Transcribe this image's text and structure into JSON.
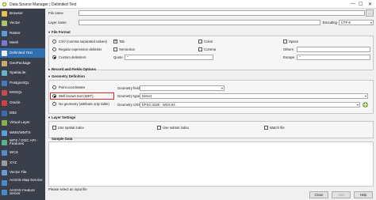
{
  "window": {
    "title": "Data Source Manager | Delimited Text",
    "controls": [
      "—",
      "☐",
      "✕"
    ]
  },
  "sidebar": {
    "items": [
      {
        "label": "Browser",
        "color": "#e8c24a",
        "active": false
      },
      {
        "label": "Vector",
        "color": "#a9c96a",
        "active": false
      },
      {
        "label": "Raster",
        "color": "#5d9bd5",
        "active": false
      },
      {
        "label": "Mesh",
        "color": "#7a7ac9",
        "active": false
      },
      {
        "label": "Delimited Text",
        "color": "#f0f0f0",
        "active": true
      },
      {
        "label": "GeoPackage",
        "color": "#c9a96a",
        "active": false
      },
      {
        "label": "SpatiaLite",
        "color": "#6ab0c9",
        "active": false
      },
      {
        "label": "PostgreSQL",
        "color": "#4a7ab5",
        "active": false
      },
      {
        "label": "MSSQL",
        "color": "#c94a4a",
        "active": false
      },
      {
        "label": "Oracle",
        "color": "#d04040",
        "active": false
      },
      {
        "label": "DB2",
        "color": "#3a6ab0",
        "active": false
      },
      {
        "label": "Virtual Layer",
        "color": "#8ab04a",
        "active": false
      },
      {
        "label": "WMS/WMTS",
        "color": "#5aa0d0",
        "active": false
      },
      {
        "label": "WFS / OGC API - Features",
        "color": "#5ab08a",
        "active": false
      },
      {
        "label": "WCS",
        "color": "#5a8ad0",
        "active": false
      },
      {
        "label": "XYZ",
        "color": "#9a9a9a",
        "active": false
      },
      {
        "label": "Vector Tile",
        "color": "#6a9ad0",
        "active": false
      },
      {
        "label": "ArcGIS Map Service",
        "color": "#4a8ac9",
        "active": false
      },
      {
        "label": "ArcGIS Feature Server",
        "color": "#4a8ac9",
        "active": false
      }
    ]
  },
  "file": {
    "file_name_label": "File name",
    "browse": "…",
    "layer_name_label": "Layer name",
    "encoding_label": "Encoding",
    "encoding_value": "UTF-8"
  },
  "file_format": {
    "title": "File Format",
    "csv": "CSV (comma separated values)",
    "regex": "Regular expression delimiter",
    "custom": "Custom delimiters",
    "tab": "Tab",
    "semicolon": "Semicolon",
    "colon": "Colon",
    "comma": "Comma",
    "space": "Space",
    "others": "Others",
    "quote_label": "Quote",
    "quote_value": "\"",
    "escape_label": "Escape",
    "escape_value": "\""
  },
  "records": {
    "title": "Record and Fields Options"
  },
  "geometry": {
    "title": "Geometry Definition",
    "point": "Point coordinates",
    "wkt": "Well known text (WKT)",
    "none": "No geometry (attribute only table)",
    "geom_field_label": "Geometry field",
    "geom_type_label": "Geometry type",
    "geom_type_value": "Detect",
    "crs_label": "Geometry CRS",
    "crs_value": "EPSG:4326 - WGS 84"
  },
  "layer_settings": {
    "title": "Layer Settings",
    "spatial_index": "Use spatial index",
    "subset_index": "Use subset index",
    "watch_file": "Watch file"
  },
  "sample": {
    "title": "Sample Data"
  },
  "status": {
    "message": "Please select an input file"
  },
  "buttons": {
    "close": "Close",
    "add": "Add",
    "help": "Help"
  }
}
